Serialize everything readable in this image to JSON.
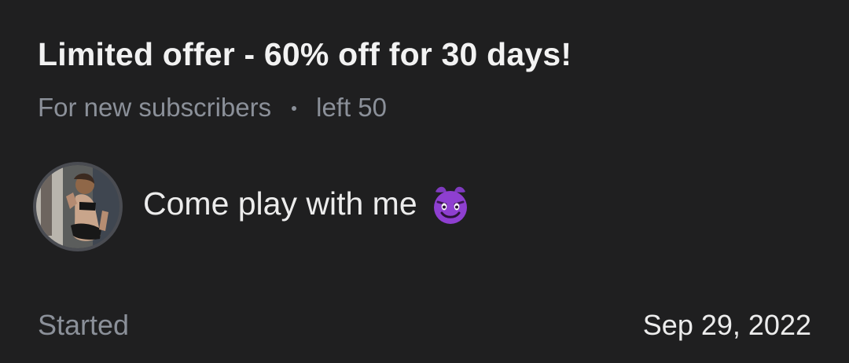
{
  "offer": {
    "title": "Limited offer - 60% off for 30 days!",
    "audience": "For new subscribers",
    "remaining": "left 50"
  },
  "profile": {
    "message": "Come play with me",
    "message_emoji": "smiling-imp-emoji"
  },
  "footer": {
    "started_label": "Started",
    "started_date": "Sep 29, 2022"
  },
  "colors": {
    "background": "#1f1f20",
    "title": "#f2f2f2",
    "muted_text": "#8b9099",
    "emoji_purple": "#8e3fd0"
  }
}
